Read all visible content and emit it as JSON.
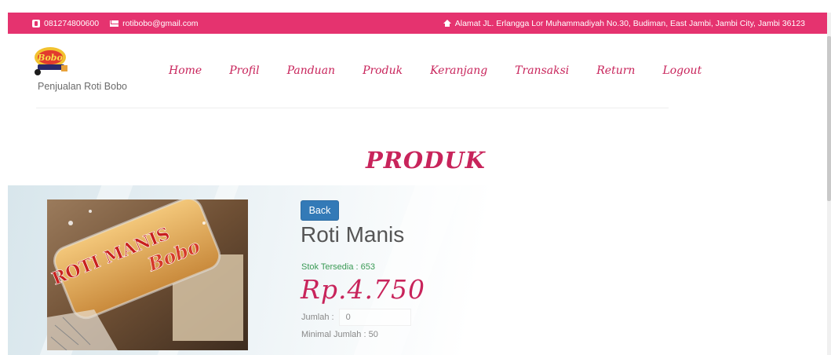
{
  "topbar": {
    "phone": "081274800600",
    "email": "rotibobo@gmail.com",
    "address": "Alamat JL. Erlangga Lor Muhammadiyah No.30, Budiman, East Jambi, Jambi City, Jambi 36123",
    "icons": [
      "phone-icon",
      "envelope-icon",
      "home-icon"
    ]
  },
  "header": {
    "brand_name": "Penjualan Roti Bobo",
    "logo_text": "Bobo",
    "nav": [
      {
        "label": "Home"
      },
      {
        "label": "Profil"
      },
      {
        "label": "Panduan"
      },
      {
        "label": "Produk"
      },
      {
        "label": "Keranjang"
      },
      {
        "label": "Transaksi"
      },
      {
        "label": "Return"
      },
      {
        "label": "Logout"
      }
    ]
  },
  "page": {
    "heading": "PRODUK"
  },
  "product": {
    "back_label": "Back",
    "name": "Roti Manis",
    "stock_label": "Stok Tersedia : 653",
    "price": "Rp.4.750",
    "qty_label": "Jumlah :",
    "qty_value": "0",
    "min_qty_label": "Minimal Jumlah : 50",
    "image_text_1": "ROTI MANIS",
    "image_text_2": "Bobo"
  },
  "colors": {
    "brand_pink": "#e5336f",
    "heading_pink": "#c8245b",
    "button_blue": "#337ab7",
    "stock_green": "#3a9a55"
  }
}
